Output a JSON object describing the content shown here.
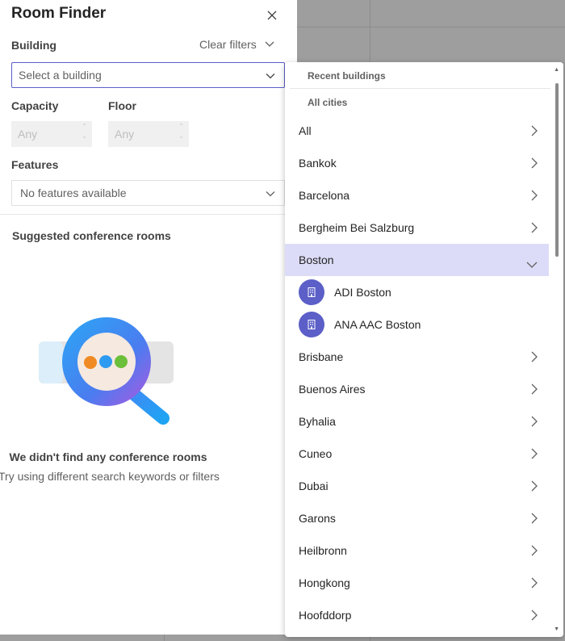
{
  "panel": {
    "title": "Room Finder",
    "building_label": "Building",
    "clear_filters": "Clear filters",
    "building_placeholder": "Select a building",
    "capacity_label": "Capacity",
    "floor_label": "Floor",
    "capacity_value": "Any",
    "floor_value": "Any",
    "features_label": "Features",
    "features_value": "No features available",
    "suggested_label": "Suggested conference rooms",
    "empty_title": "We didn't find any conference rooms",
    "empty_subtitle": "Try using different search keywords or filters"
  },
  "dropdown": {
    "recent_header": "Recent buildings",
    "cities_header": "All cities",
    "cities": [
      {
        "label": "All"
      },
      {
        "label": "Bankok"
      },
      {
        "label": "Barcelona"
      },
      {
        "label": "Bergheim Bei Salzburg"
      },
      {
        "label": "Boston",
        "expanded": true,
        "buildings": [
          "ADI Boston",
          "ANA AAC Boston"
        ]
      },
      {
        "label": "Brisbane"
      },
      {
        "label": "Buenos Aires"
      },
      {
        "label": "Byhalia"
      },
      {
        "label": "Cuneo"
      },
      {
        "label": "Dubai"
      },
      {
        "label": "Garons"
      },
      {
        "label": "Heilbronn"
      },
      {
        "label": "Hongkong"
      },
      {
        "label": "Hoofddorp"
      }
    ]
  },
  "colors": {
    "accent": "#5b5fc7",
    "selected_row": "#dcdcf8"
  }
}
